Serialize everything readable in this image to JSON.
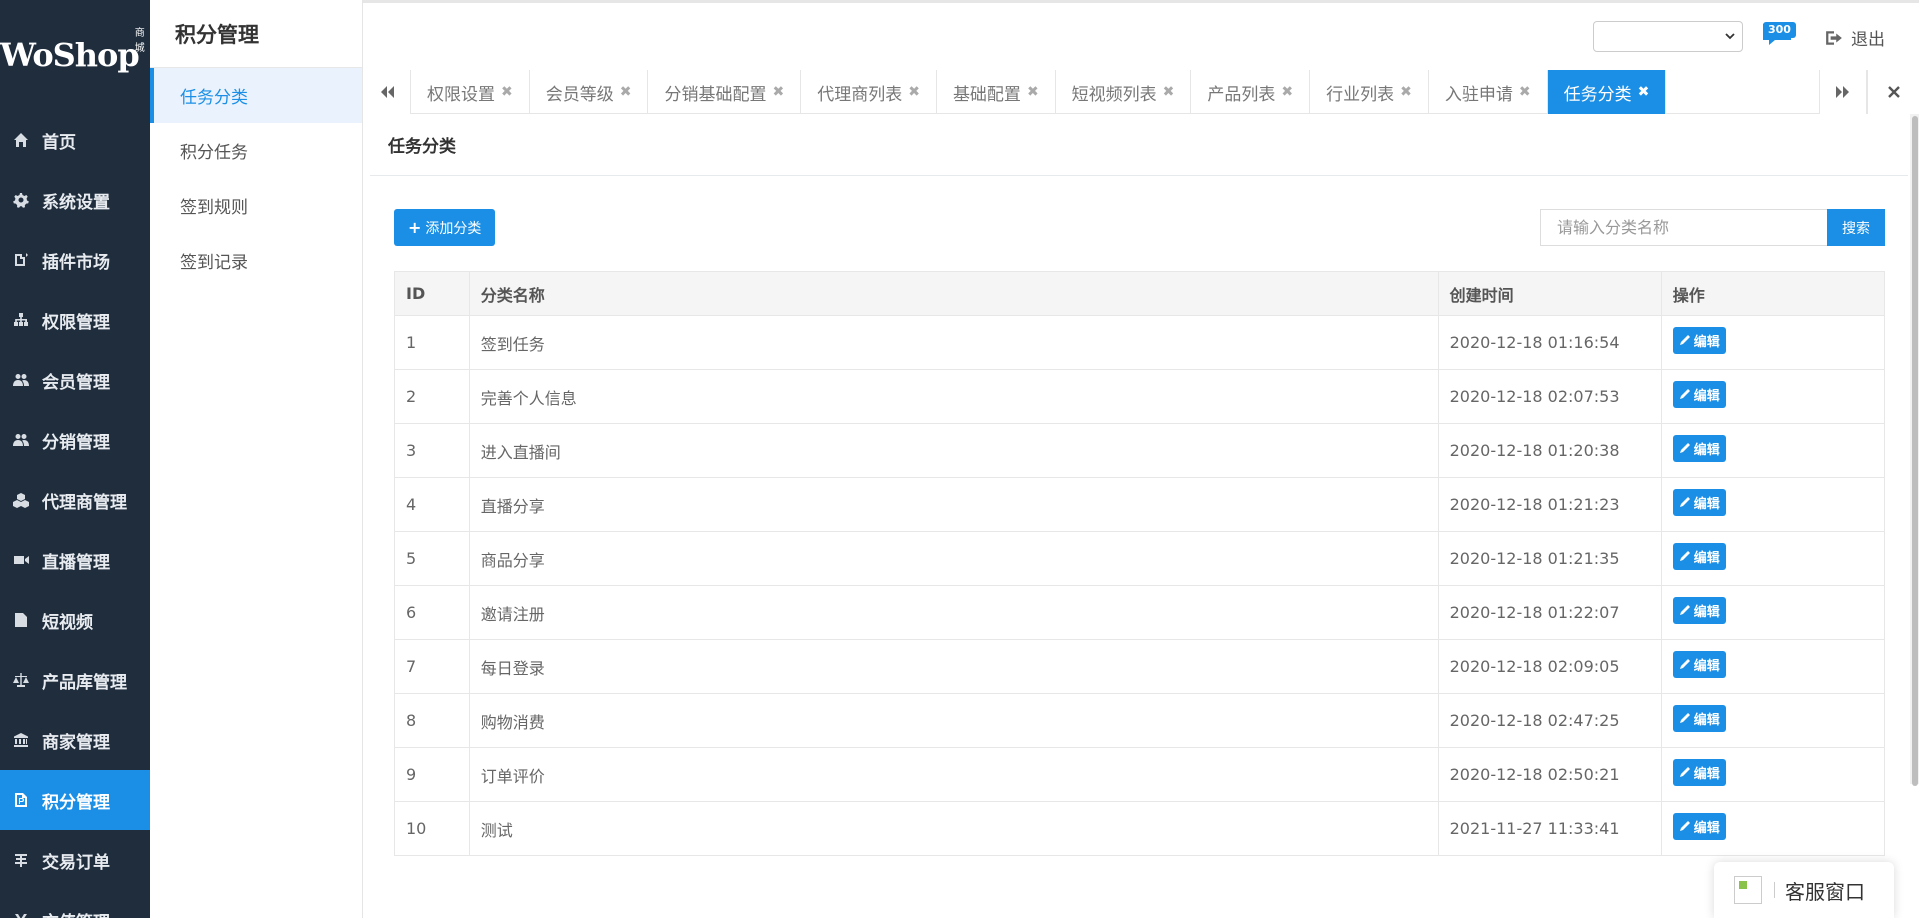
{
  "app": {
    "logo_text": "WoShop",
    "logo_badge": "商城"
  },
  "sidebar": {
    "items": [
      {
        "label": "首页",
        "icon": "home-icon"
      },
      {
        "label": "系统设置",
        "icon": "gear-icon"
      },
      {
        "label": "插件市场",
        "icon": "plugin-icon"
      },
      {
        "label": "权限管理",
        "icon": "sitemap-icon"
      },
      {
        "label": "会员管理",
        "icon": "users-icon"
      },
      {
        "label": "分销管理",
        "icon": "users-icon"
      },
      {
        "label": "代理商管理",
        "icon": "cubes-icon"
      },
      {
        "label": "直播管理",
        "icon": "video-icon"
      },
      {
        "label": "短视频",
        "icon": "file-video-icon"
      },
      {
        "label": "产品库管理",
        "icon": "balance-scale-icon"
      },
      {
        "label": "商家管理",
        "icon": "bank-icon"
      },
      {
        "label": "积分管理",
        "icon": "points-icon",
        "active": true
      },
      {
        "label": "交易订单",
        "icon": "order-icon"
      },
      {
        "label": "充值管理",
        "icon": "recharge-icon"
      }
    ]
  },
  "subsidebar": {
    "title": "积分管理",
    "items": [
      {
        "label": "任务分类",
        "active": true
      },
      {
        "label": "积分任务"
      },
      {
        "label": "签到规则"
      },
      {
        "label": "签到记录"
      }
    ]
  },
  "header": {
    "message_count": "300",
    "logout_label": "退出"
  },
  "tabs": [
    {
      "label": "权限设置"
    },
    {
      "label": "会员等级"
    },
    {
      "label": "分销基础配置"
    },
    {
      "label": "代理商列表"
    },
    {
      "label": "基础配置"
    },
    {
      "label": "短视频列表"
    },
    {
      "label": "产品列表"
    },
    {
      "label": "行业列表"
    },
    {
      "label": "入驻申请"
    },
    {
      "label": "任务分类",
      "active": true
    }
  ],
  "main": {
    "panel_title": "任务分类",
    "add_button": "添加分类",
    "search_placeholder": "请输入分类名称",
    "search_button": "搜索",
    "columns": [
      "ID",
      "分类名称",
      "创建时间",
      "操作"
    ],
    "edit_label": "编辑",
    "rows": [
      {
        "id": "1",
        "name": "签到任务",
        "created": "2020-12-18 01:16:54"
      },
      {
        "id": "2",
        "name": "完善个人信息",
        "created": "2020-12-18 02:07:53"
      },
      {
        "id": "3",
        "name": "进入直播间",
        "created": "2020-12-18 01:20:38"
      },
      {
        "id": "4",
        "name": "直播分享",
        "created": "2020-12-18 01:21:23"
      },
      {
        "id": "5",
        "name": "商品分享",
        "created": "2020-12-18 01:21:35"
      },
      {
        "id": "6",
        "name": "邀请注册",
        "created": "2020-12-18 01:22:07"
      },
      {
        "id": "7",
        "name": "每日登录",
        "created": "2020-12-18 02:09:05"
      },
      {
        "id": "8",
        "name": "购物消费",
        "created": "2020-12-18 02:47:25"
      },
      {
        "id": "9",
        "name": "订单评价",
        "created": "2020-12-18 02:50:21"
      },
      {
        "id": "10",
        "name": "测试",
        "created": "2021-11-27 11:33:41"
      }
    ]
  },
  "cs_widget": {
    "label": "客服窗口"
  },
  "colors": {
    "accent": "#1b8fe5",
    "sidebar_bg": "#1f2d3d"
  }
}
